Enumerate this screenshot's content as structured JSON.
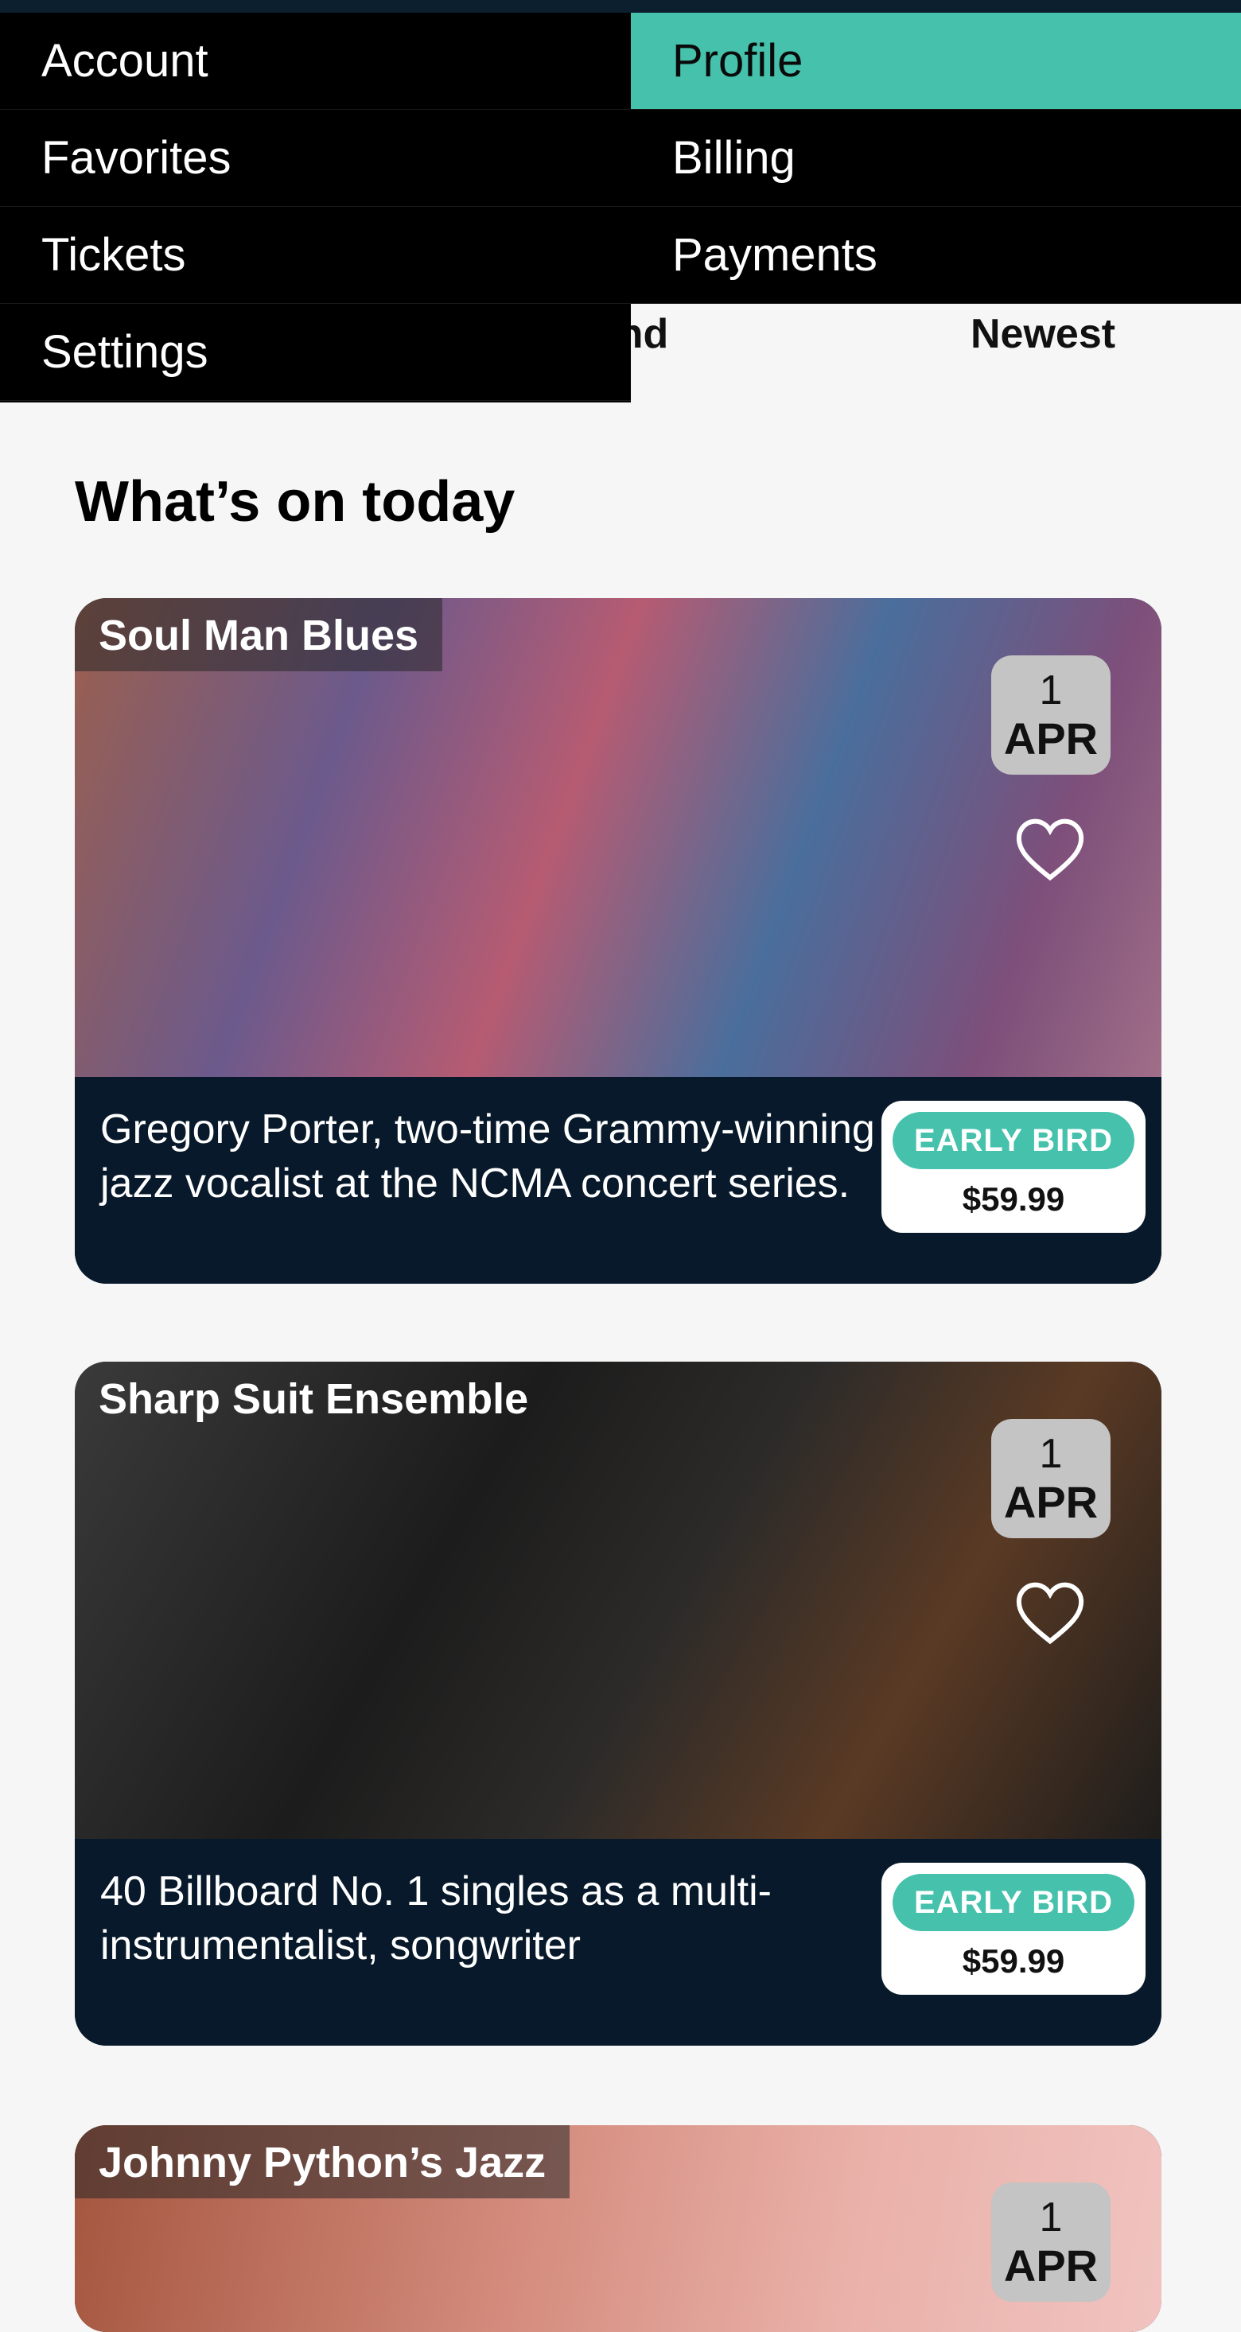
{
  "menus": {
    "left": [
      "Account",
      "Favorites",
      "Tickets",
      "Settings"
    ],
    "right": [
      "Profile",
      "Billing",
      "Payments"
    ],
    "right_active": "Profile"
  },
  "filters": {
    "weekend_partial": "ekend",
    "newest": "Newest"
  },
  "section_title": "What’s on today",
  "cards": [
    {
      "title": "Soul Man Blues",
      "date_day": "1",
      "date_month": "APR",
      "description": "Gregory Porter, two-time Grammy-winning jazz vocalist at the NCMA concert series.",
      "badge": "EARLY BIRD",
      "price": "$59.99"
    },
    {
      "title": "Sharp Suit Ensemble",
      "date_day": "1",
      "date_month": "APR",
      "description": "40 Billboard No. 1 singles as a multi-instrumentalist, songwriter",
      "badge": "EARLY BIRD",
      "price": "$59.99"
    },
    {
      "title": "Johnny Python’s Jazz",
      "date_day": "1",
      "date_month": "APR"
    }
  ],
  "colors": {
    "accent": "#45c1ac",
    "card_footer": "#07192a",
    "menu_bg": "#000000",
    "page_bg": "#f6f6f7"
  }
}
